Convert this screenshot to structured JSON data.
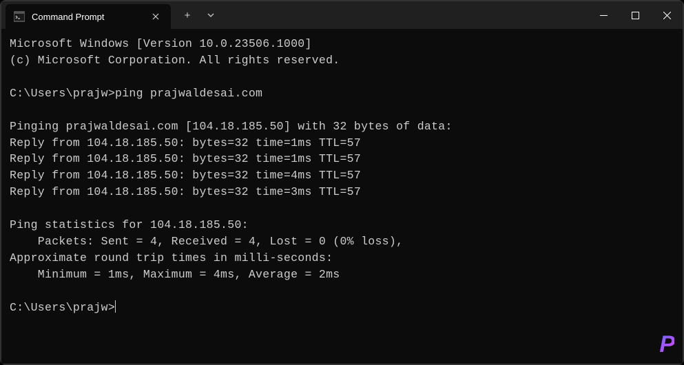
{
  "titlebar": {
    "tab_title": "Command Prompt",
    "new_tab_label": "+",
    "dropdown_label": "⌄"
  },
  "terminal": {
    "lines": [
      "Microsoft Windows [Version 10.0.23506.1000]",
      "(c) Microsoft Corporation. All rights reserved.",
      "",
      "C:\\Users\\prajw>ping prajwaldesai.com",
      "",
      "Pinging prajwaldesai.com [104.18.185.50] with 32 bytes of data:",
      "Reply from 104.18.185.50: bytes=32 time=1ms TTL=57",
      "Reply from 104.18.185.50: bytes=32 time=1ms TTL=57",
      "Reply from 104.18.185.50: bytes=32 time=4ms TTL=57",
      "Reply from 104.18.185.50: bytes=32 time=3ms TTL=57",
      "",
      "Ping statistics for 104.18.185.50:",
      "    Packets: Sent = 4, Received = 4, Lost = 0 (0% loss),",
      "Approximate round trip times in milli-seconds:",
      "    Minimum = 1ms, Maximum = 4ms, Average = 2ms",
      ""
    ],
    "prompt": "C:\\Users\\prajw>"
  },
  "watermark": "P"
}
